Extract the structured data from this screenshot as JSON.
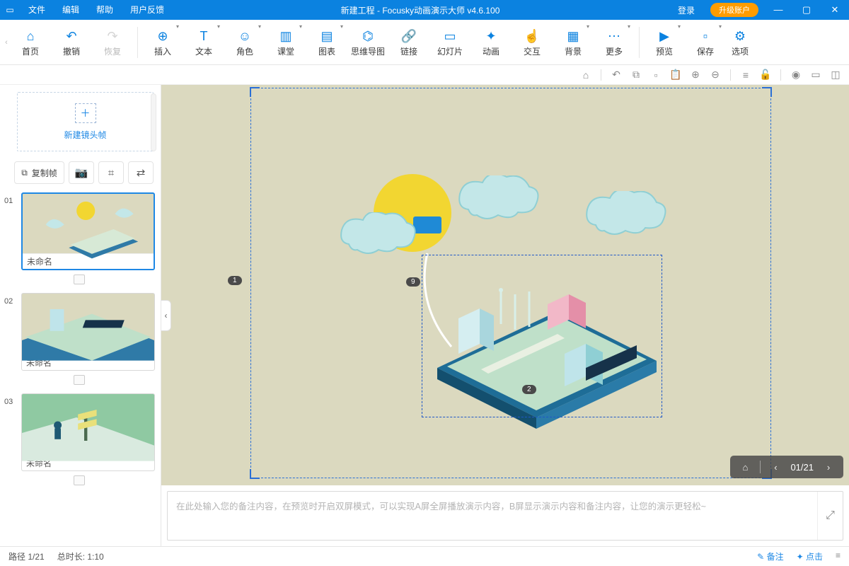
{
  "titlebar": {
    "menus": [
      "文件",
      "编辑",
      "帮助",
      "用户反馈"
    ],
    "title": "新建工程 - Focusky动画演示大师  v4.6.100",
    "login": "登录",
    "upgrade": "升级账户"
  },
  "toolbar": {
    "home": "首页",
    "undo": "撤销",
    "redo": "恢复",
    "insert": "插入",
    "text": "文本",
    "role": "角色",
    "class": "课堂",
    "chart": "图表",
    "mind": "思维导图",
    "link": "链接",
    "slide": "幻灯片",
    "anim": "动画",
    "interact": "交互",
    "bg": "背景",
    "more": "更多",
    "preview": "预览",
    "save": "保存",
    "option": "选项"
  },
  "side": {
    "newframe": "新建镜头帧",
    "copy": "复制帧",
    "slides": [
      {
        "num": "01",
        "cap": "未命名"
      },
      {
        "num": "02",
        "cap": "未命名"
      },
      {
        "num": "03",
        "cap": "未命名"
      }
    ]
  },
  "notes": {
    "placeholder": "在此处输入您的备注内容，在预览时开启双屏模式，可以实现A屏全屏播放演示内容，B屏显示演示内容和备注内容，让您的演示更轻松~"
  },
  "pager": {
    "count": "01/21"
  },
  "markers": {
    "m1": "1",
    "m2": "2",
    "m9": "9"
  },
  "status": {
    "path": "路径 1/21",
    "dur": "总时长: 1:10",
    "note": "备注",
    "dot": "点击"
  }
}
